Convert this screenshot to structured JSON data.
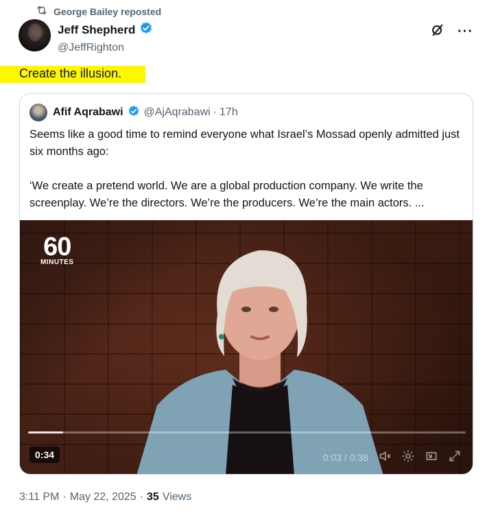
{
  "repost": {
    "icon": "repost-icon",
    "text": "George Bailey reposted"
  },
  "author": {
    "name": "Jeff Shepherd",
    "handle": "@JeffRighton",
    "verified_color": "#1d9bf0"
  },
  "post": {
    "text": "Create the illusion.",
    "highlight_color": "#fff600"
  },
  "quote": {
    "name": "Afif Aqrabawi",
    "handle": "@AjAqrabawi",
    "separator": "·",
    "time": "17h",
    "paragraphs": [
      "Seems like a good time to remind everyone what Israel’s Mossad openly admitted just six months ago:",
      "‘We create a pretend world. We are a global production company. We write the screenplay. We’re the directors. We’re the producers. We’re the main actors. ..."
    ]
  },
  "video": {
    "logo_number": "60",
    "logo_word": "MINUTES",
    "duration_badge": "0:34",
    "time_readout": "0:03 / 0:38",
    "progress": 0.08
  },
  "footer": {
    "time": "3:11 PM",
    "sep1": "·",
    "date": "May 22, 2025",
    "sep2": "·",
    "views_count": "35",
    "views_label": "Views"
  }
}
